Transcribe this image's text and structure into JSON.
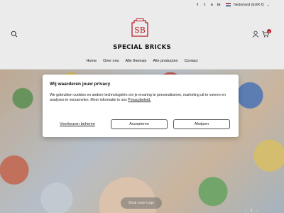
{
  "topbar": {
    "social": [
      "f",
      "t",
      "o",
      "in"
    ],
    "language": "Nederland (EUR €)"
  },
  "header": {
    "logo_text": "SB",
    "brand": "SPECIAL BRICKS",
    "cart_count": "0",
    "nav": [
      "Home",
      "Over ons",
      "Alle themais",
      "Alle producten",
      "Contact"
    ]
  },
  "hero": {
    "button": "Shop onze Lego"
  },
  "cookie": {
    "title": "Wij waarderen jouw privacy",
    "text": "We gebruiken cookies en andere technologieën om je ervaring te personaliseren, marketing uit te voeren en analyses te verzamelen. Meer informatie in ons",
    "link": "Privacybeleid.",
    "preferences": "Voorkeuren beheren",
    "accept": "Accepteren",
    "reject": "Afwijzen"
  },
  "colors": {
    "accent": "#c8202e"
  }
}
